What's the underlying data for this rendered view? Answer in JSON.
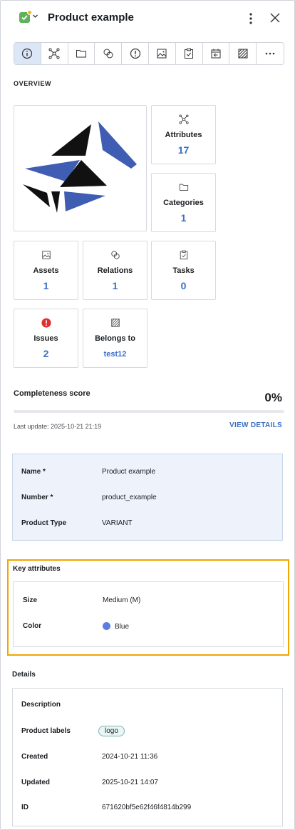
{
  "header": {
    "title": "Product example"
  },
  "tabs": [
    {
      "icon": "info-icon",
      "active": true
    },
    {
      "icon": "attributes-icon"
    },
    {
      "icon": "folder-icon"
    },
    {
      "icon": "relations-icon"
    },
    {
      "icon": "alert-icon"
    },
    {
      "icon": "image-icon"
    },
    {
      "icon": "tasks-icon"
    },
    {
      "icon": "history-icon"
    },
    {
      "icon": "pattern-icon"
    },
    {
      "icon": "more-icon"
    }
  ],
  "overview": {
    "label": "OVERVIEW",
    "cards": {
      "attributes": {
        "label": "Attributes",
        "value": "17"
      },
      "categories": {
        "label": "Categories",
        "value": "1"
      },
      "assets": {
        "label": "Assets",
        "value": "1"
      },
      "relations": {
        "label": "Relations",
        "value": "1"
      },
      "tasks": {
        "label": "Tasks",
        "value": "0"
      },
      "issues": {
        "label": "Issues",
        "value": "2"
      },
      "belongs_to": {
        "label": "Belongs to",
        "value": "test12"
      }
    }
  },
  "completeness": {
    "title": "Completeness score",
    "percent": "0%",
    "progress": 0,
    "last_update": "Last update: 2025-10-21 21:19",
    "link": "VIEW DETAILS"
  },
  "info": {
    "name_label": "Name *",
    "name_value": "Product example",
    "number_label": "Number *",
    "number_value": "product_example",
    "type_label": "Product Type",
    "type_value": "VARIANT"
  },
  "key_attributes": {
    "title": "Key attributes",
    "size_label": "Size",
    "size_value": "Medium (M)",
    "color_label": "Color",
    "color_value": "Blue",
    "color_hex": "#5b7ee3"
  },
  "details": {
    "title": "Details",
    "description_label": "Description",
    "labels_label": "Product labels",
    "labels_value": "logo",
    "created_label": "Created",
    "created_value": "2024-10-21 11:36",
    "updated_label": "Updated",
    "updated_value": "2025-10-21 14:07",
    "id_label": "ID",
    "id_value": "671620bf5e62f46f4814b299"
  },
  "colors": {
    "accent": "#3a6fc4",
    "highlight_border": "#f0a500",
    "issue_red": "#e03131"
  }
}
